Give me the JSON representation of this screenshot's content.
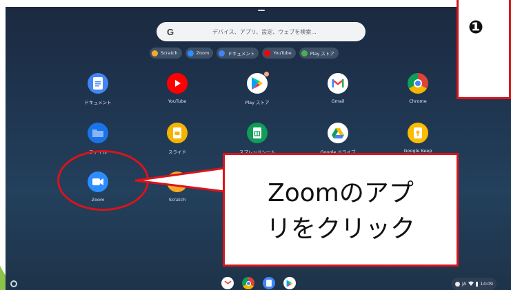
{
  "search": {
    "placeholder": "デバイス、アプリ、設定、ウェブを検索...",
    "logo": "G"
  },
  "chips": [
    {
      "label": "Scratch",
      "color": "#f9a825"
    },
    {
      "label": "Zoom",
      "color": "#2d8cff"
    },
    {
      "label": "ドキュメント",
      "color": "#4285f4"
    },
    {
      "label": "YouTube",
      "color": "#ff0000"
    },
    {
      "label": "Play ストア",
      "color": "#4caf50"
    }
  ],
  "apps": [
    {
      "label": "ドキュメント",
      "icon": "docs-icon",
      "color": "#4285f4"
    },
    {
      "label": "YouTube",
      "icon": "youtube-icon",
      "color": "#ff0000"
    },
    {
      "label": "Play ストア",
      "icon": "play-store-icon",
      "color": "#ffffff"
    },
    {
      "label": "Gmail",
      "icon": "gmail-icon",
      "color": "#ffffff"
    },
    {
      "label": "Chrome",
      "icon": "chrome-icon",
      "color": "#ffffff"
    },
    {
      "label": "ファイル",
      "icon": "files-icon",
      "color": "#1a73e8"
    },
    {
      "label": "スライド",
      "icon": "slides-icon",
      "color": "#f4b400"
    },
    {
      "label": "スプレッドシート",
      "icon": "sheets-icon",
      "color": "#0f9d58"
    },
    {
      "label": "Google ドライブ",
      "icon": "drive-icon",
      "color": "#ffffff"
    },
    {
      "label": "Google Keep",
      "icon": "keep-icon",
      "color": "#fbbc04"
    },
    {
      "label": "Zoom",
      "icon": "zoom-icon",
      "color": "#2d8cff"
    },
    {
      "label": "Scratch",
      "icon": "scratch-icon",
      "color": "#f9a825"
    }
  ],
  "status": {
    "language": "JA",
    "time": "14:09"
  },
  "callout": {
    "line1": "Zoomのアプ",
    "line2": "リをクリック"
  },
  "callout_top": {
    "text": "❶"
  }
}
